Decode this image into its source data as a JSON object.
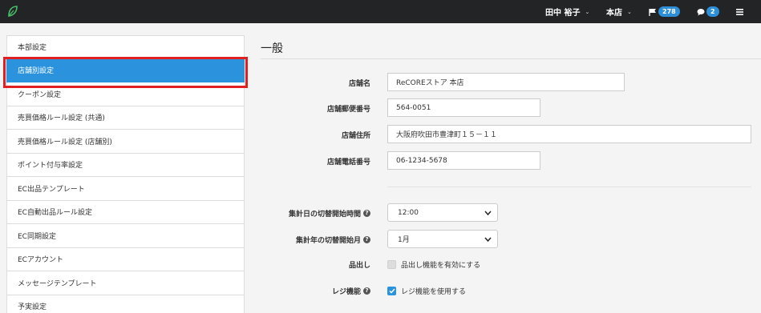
{
  "navbar": {
    "logo_icon": "leaf-logo-icon",
    "user_name": "田中 裕子",
    "store_name": "本店",
    "flag_count": "278",
    "comment_count": "2",
    "menu_icon": "hamburger-icon",
    "accent": "#2d8fd8"
  },
  "sidebar": {
    "items": [
      {
        "label": "本部設定"
      },
      {
        "label": "店舗別設定"
      },
      {
        "label": "クーポン設定"
      },
      {
        "label": "売買価格ルール設定 (共通)"
      },
      {
        "label": "売買価格ルール設定 (店舗別)"
      },
      {
        "label": "ポイント付与率設定"
      },
      {
        "label": "EC出品テンプレート"
      },
      {
        "label": "EC自動出品ルール設定"
      },
      {
        "label": "EC同期設定"
      },
      {
        "label": "ECアカウント"
      },
      {
        "label": "メッセージテンプレート"
      },
      {
        "label": "予実設定"
      }
    ],
    "active_index": 1,
    "active_color": "#2b93dd",
    "highlight_color": "#e02020"
  },
  "main": {
    "title": "一般",
    "fields": {
      "store_name": {
        "label": "店舗名",
        "value": "ReCOREストア 本店"
      },
      "postal_code": {
        "label": "店舗郵便番号",
        "value": "564-0051"
      },
      "address": {
        "label": "店舗住所",
        "value": "大阪府吹田市豊津町１５－１１"
      },
      "phone": {
        "label": "店舗電話番号",
        "value": "06-1234-5678"
      },
      "day_switch_time": {
        "label": "集計日の切替開始時間",
        "value": "12:00"
      },
      "year_switch_month": {
        "label": "集計年の切替開始月",
        "value": "1月"
      },
      "shipping": {
        "label": "品出し",
        "checkbox_label": "品出し機能を有効にする",
        "checked": false
      },
      "register": {
        "label": "レジ機能",
        "checkbox_label": "レジ機能を使用する",
        "checked": true
      }
    }
  }
}
